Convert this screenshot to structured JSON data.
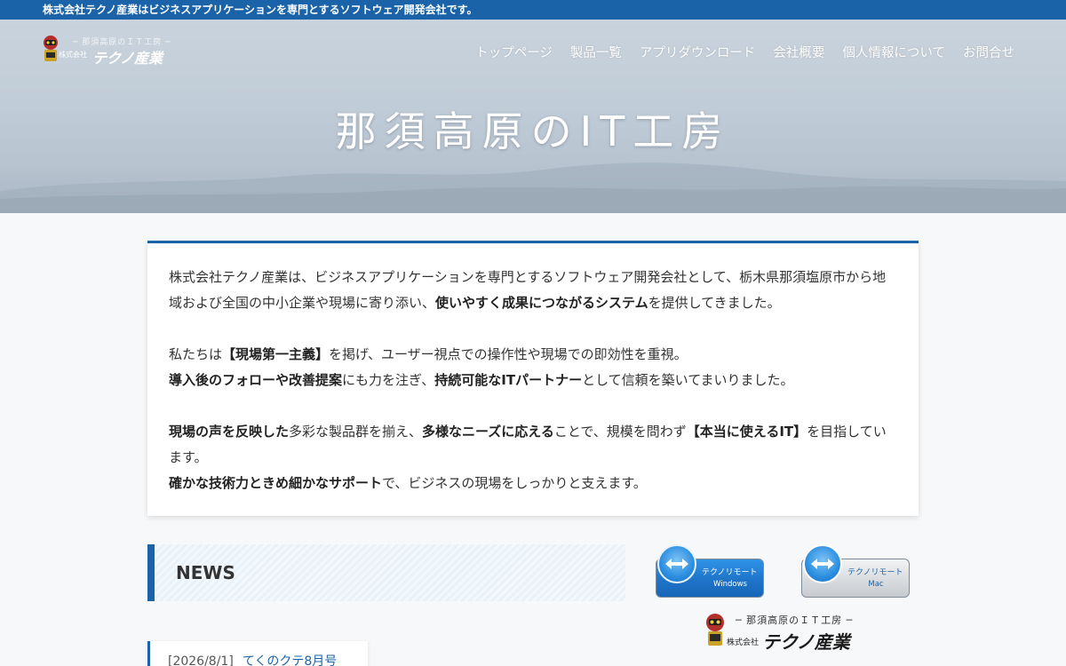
{
  "topbar": {
    "text": "株式会社テクノ産業はビジネスアプリケーションを専門とするソフトウェア開発会社です。"
  },
  "header": {
    "logo": {
      "subtitle": "─ 那須高原のＩＴ工房 ─",
      "kabushiki": "株式会社",
      "name": "テクノ産業"
    },
    "nav": [
      {
        "label": "トップページ"
      },
      {
        "label": "製品一覧"
      },
      {
        "label": "アプリダウンロード"
      },
      {
        "label": "会社概要"
      },
      {
        "label": "個人情報について"
      },
      {
        "label": "お問合せ"
      }
    ]
  },
  "hero": {
    "title": "那須高原のIT工房"
  },
  "intro": {
    "p1": {
      "a": "株式会社テクノ産業は、ビジネスアプリケーションを専門とするソフトウェア開発会社として、栃木県那須塩原市から地域および全国の中小企業や現場に寄り添い、",
      "b": "使いやすく成果につながるシステム",
      "c": "を提供してきました。"
    },
    "p2": {
      "a": "私たちは",
      "b": "【現場第一主義】",
      "c": "を掲げ、ユーザー視点での操作性や現場での即効性を重視。",
      "d": "導入後のフォローや改善提案",
      "e": "にも力を注ぎ、",
      "f": "持続可能なITパートナー",
      "g": "として信頼を築いてまいりました。"
    },
    "p3": {
      "a": "現場の声を反映した",
      "b": "多彩な製品群を揃え、",
      "c": "多様なニーズに応える",
      "d": "ことで、規模を問わず",
      "e": "【本当に使えるIT】",
      "f": "を目指しています。",
      "g": "確かな技術力ときめ細かなサポート",
      "h": "で、ビジネスの現場をしっかりと支えます。"
    }
  },
  "news": {
    "heading": "NEWS",
    "items": [
      {
        "date": "[2026/8/1]",
        "title": "てくのクテ8月号"
      }
    ]
  },
  "remote": {
    "windows": {
      "line1": "テクノリモート",
      "line2": "Windows"
    },
    "mac": {
      "line1": "テクノリモート",
      "line2": "Mac"
    }
  },
  "footer_logo": {
    "subtitle": "─ 那須高原のＩＴ工房 ─",
    "kabushiki": "株式会社",
    "name": "テクノ産業"
  },
  "colors": {
    "accent": "#1a63a8",
    "topbar": "#1a63a8",
    "hero": "#c0ccd7"
  }
}
